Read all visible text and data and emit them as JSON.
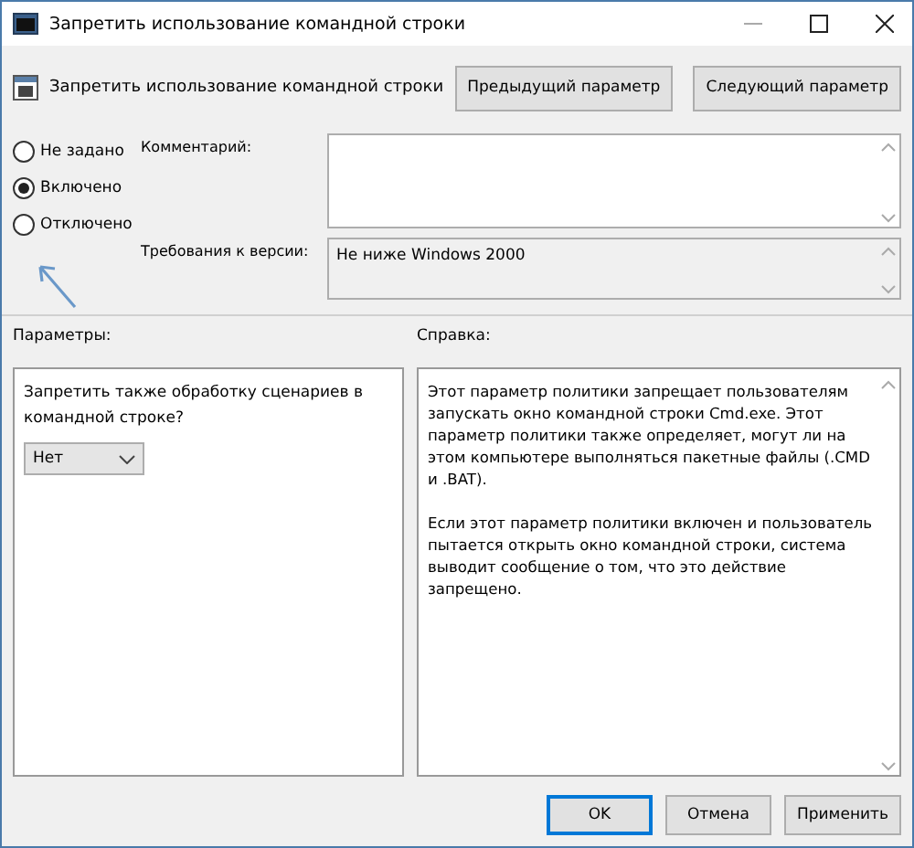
{
  "window": {
    "title": "Запретить использование командной строки"
  },
  "header": {
    "policy_name": "Запретить использование командной строки",
    "buttons": [
      "Предыдущий параметр",
      "Следующий параметр"
    ]
  },
  "state_options": [
    {
      "label": "Не задано",
      "selected": false
    },
    {
      "label": "Включено",
      "selected": true
    },
    {
      "label": "Отключено",
      "selected": false
    }
  ],
  "comment": {
    "label": "Комментарий:"
  },
  "requirements": {
    "label": "Требования к версии:",
    "value": "Не ниже Windows 2000"
  },
  "options": {
    "label": "Параметры:",
    "question": "Запретить также обработку сценариев в командной строке?",
    "dropdown": "Нет"
  },
  "help": {
    "label": "Справка:",
    "paragraphs": [
      "Этот параметр политики запрещает пользователям запускать окно командной строки Cmd.exe.  Этот параметр политики также определяет, могут ли на этом компьютере выполняться пакетные файлы (.CMD и .BAT).",
      "Если этот параметр политики включен и пользователь пытается открыть окно командной строки, система выводит сообщение о том, что это действие запрещено."
    ]
  },
  "buttons": [
    {
      "label": "OK",
      "kind": "default"
    },
    {
      "label": "Отмена",
      "kind": "normal"
    },
    {
      "label": "Применить",
      "kind": "normal"
    }
  ]
}
